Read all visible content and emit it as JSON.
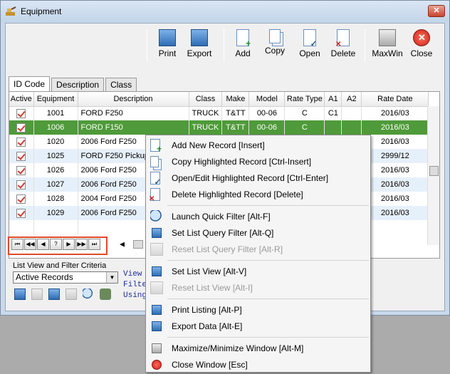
{
  "window": {
    "title": "Equipment",
    "close_label": "✕"
  },
  "toolbar": [
    {
      "name": "print-button",
      "label": "Print",
      "icon": "print-icon"
    },
    {
      "name": "export-button",
      "label": "Export",
      "icon": "export-icon"
    },
    {
      "name": "add-button",
      "label": "Add",
      "icon": "add-icon"
    },
    {
      "name": "copy-button",
      "label": "Copy",
      "icon": "copy-icon"
    },
    {
      "name": "open-button",
      "label": "Open",
      "icon": "open-icon"
    },
    {
      "name": "delete-button",
      "label": "Delete",
      "icon": "delete-icon"
    },
    {
      "name": "maxwin-button",
      "label": "MaxWin",
      "icon": "maxwin-icon"
    },
    {
      "name": "close-button",
      "label": "Close",
      "icon": "close-icon"
    }
  ],
  "tabs": [
    "ID Code",
    "Description",
    "Class"
  ],
  "grid": {
    "columns": [
      "Active",
      "Equipment",
      "Description",
      "Class",
      "Make",
      "Model",
      "Rate Type",
      "A1",
      "A2",
      "Rate Date"
    ],
    "rows": [
      [
        "1001",
        "FORD F250",
        "TRUCK",
        "T&TT",
        "00-06",
        "C",
        "C1",
        "",
        "2016/03"
      ],
      [
        "1006",
        "FORD F150",
        "TRUCK",
        "T&TT",
        "00-06",
        "C",
        "",
        "",
        "2016/03"
      ],
      [
        "1020",
        "2006 Ford F250",
        "",
        "",
        "",
        "",
        "",
        "",
        "2016/03"
      ],
      [
        "1025",
        "FORD F250 Pickup",
        "",
        "",
        "",
        "",
        "",
        "",
        "2999/12"
      ],
      [
        "1026",
        "2006 Ford F250",
        "",
        "",
        "",
        "",
        "",
        "",
        "2016/03"
      ],
      [
        "1027",
        "2006 Ford F250",
        "",
        "",
        "",
        "",
        "",
        "",
        "2016/03"
      ],
      [
        "1028",
        "2004 Ford F250",
        "",
        "",
        "",
        "",
        "",
        "",
        "2016/03"
      ],
      [
        "1029",
        "2006 Ford F250",
        "",
        "",
        "",
        "",
        "",
        "",
        "2016/03"
      ]
    ]
  },
  "navigator": [
    "⏮",
    "◀◀",
    "◀",
    "?",
    "▶",
    "▶▶",
    "⏭"
  ],
  "filter": {
    "label": "List View and Filter Criteria",
    "selected": "Active Records",
    "mono_lines": [
      "View",
      "Filte",
      "Using"
    ]
  },
  "context_menu": [
    {
      "label": "Add New Record  [Insert]",
      "icon": "add-record-icon",
      "disabled": false
    },
    {
      "label": "Copy Highlighted Record  [Ctrl-Insert]",
      "icon": "copy-record-icon",
      "disabled": false
    },
    {
      "label": "Open/Edit Highlighted Record  [Ctrl-Enter]",
      "icon": "open-record-icon",
      "disabled": false
    },
    {
      "label": "Delete Highlighted Record  [Delete]",
      "icon": "delete-record-icon",
      "disabled": false
    },
    {
      "label": "Launch Quick Filter  [Alt-F]",
      "icon": "quick-filter-icon",
      "disabled": false
    },
    {
      "label": "Set List Query Filter  [Alt-Q]",
      "icon": "query-filter-icon",
      "disabled": false
    },
    {
      "label": "Reset List Query Filter  [Alt-R]",
      "icon": "reset-filter-icon",
      "disabled": true
    },
    {
      "label": "Set List View  [Alt-V]",
      "icon": "list-view-icon",
      "disabled": false
    },
    {
      "label": "Reset List View  [Alt-I]",
      "icon": "reset-view-icon",
      "disabled": true
    },
    {
      "label": "Print Listing  [Alt-P]",
      "icon": "print-icon",
      "disabled": false
    },
    {
      "label": "Export Data  [Alt-E]",
      "icon": "export-icon",
      "disabled": false
    },
    {
      "label": "Maximize/Minimize Window  [Alt-M]",
      "icon": "maximize-icon",
      "disabled": false
    },
    {
      "label": "Close Window  [Esc]",
      "icon": "close-window-icon",
      "disabled": false
    }
  ]
}
